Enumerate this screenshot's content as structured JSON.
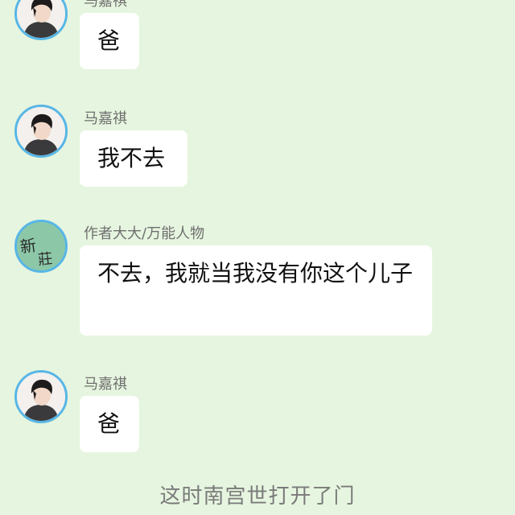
{
  "messages": [
    {
      "sender": "马嘉祺",
      "text": "爸",
      "avatar_icon": "person-photo-avatar"
    },
    {
      "sender": "马嘉祺",
      "text": "我不去",
      "avatar_icon": "person-photo-avatar"
    },
    {
      "sender": "作者大大/万能人物",
      "text": "不去，我就当我没有你这个儿子",
      "avatar_icon": "handwritten-logo-avatar",
      "avatar_mark": "新莊"
    },
    {
      "sender": "马嘉祺",
      "text": "爸",
      "avatar_icon": "person-photo-avatar"
    }
  ],
  "narration": "这时南宫世打开了门",
  "colors": {
    "background": "#e6f5df",
    "avatar_border": "#57b6e6",
    "bubble": "#ffffff",
    "author_avatar_bg": "#8cc8a8"
  }
}
